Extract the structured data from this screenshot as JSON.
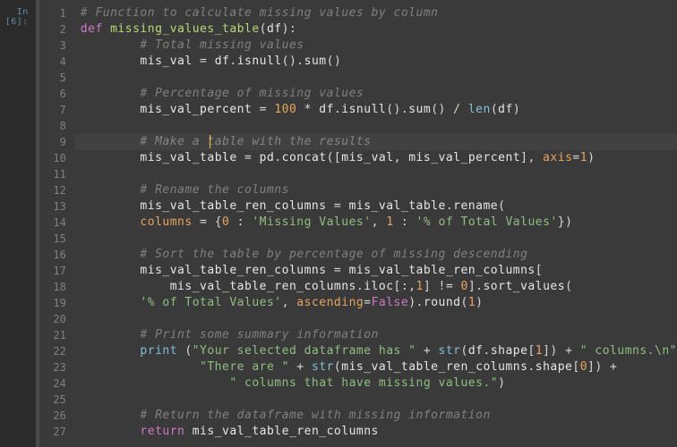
{
  "prompt": "In [6]:",
  "cursor_line": 9,
  "caret_col_ch": 18,
  "lines": [
    {
      "n": 1,
      "t": [
        [
          "c",
          "# Function to calculate missing values by column"
        ]
      ],
      "indent": 0
    },
    {
      "n": 2,
      "t": [
        [
          "kw",
          "def "
        ],
        [
          "fn",
          "missing_values_table"
        ],
        [
          "op",
          "("
        ],
        [
          "id",
          "df"
        ],
        [
          "op",
          "):"
        ]
      ],
      "indent": 0
    },
    {
      "n": 3,
      "t": [
        [
          "c",
          "# Total missing values"
        ]
      ],
      "indent": 2
    },
    {
      "n": 4,
      "t": [
        [
          "id",
          "mis_val "
        ],
        [
          "op",
          "= "
        ],
        [
          "id",
          "df"
        ],
        [
          "op",
          "."
        ],
        [
          "id",
          "isnull"
        ],
        [
          "op",
          "()."
        ],
        [
          "id",
          "sum"
        ],
        [
          "op",
          "()"
        ]
      ],
      "indent": 2
    },
    {
      "n": 5,
      "t": [],
      "indent": 0
    },
    {
      "n": 6,
      "t": [
        [
          "c",
          "# Percentage of missing values"
        ]
      ],
      "indent": 2
    },
    {
      "n": 7,
      "t": [
        [
          "id",
          "mis_val_percent "
        ],
        [
          "op",
          "= "
        ],
        [
          "nm",
          "100"
        ],
        [
          "op",
          " * "
        ],
        [
          "id",
          "df"
        ],
        [
          "op",
          "."
        ],
        [
          "id",
          "isnull"
        ],
        [
          "op",
          "()."
        ],
        [
          "id",
          "sum"
        ],
        [
          "op",
          "() / "
        ],
        [
          "bf",
          "len"
        ],
        [
          "op",
          "("
        ],
        [
          "id",
          "df"
        ],
        [
          "op",
          ")"
        ]
      ],
      "indent": 2
    },
    {
      "n": 8,
      "t": [],
      "indent": 0
    },
    {
      "n": 9,
      "t": [
        [
          "c",
          "# Make a table with the results"
        ]
      ],
      "indent": 2
    },
    {
      "n": 10,
      "t": [
        [
          "id",
          "mis_val_table "
        ],
        [
          "op",
          "= "
        ],
        [
          "id",
          "pd"
        ],
        [
          "op",
          "."
        ],
        [
          "id",
          "concat"
        ],
        [
          "op",
          "(["
        ],
        [
          "id",
          "mis_val"
        ],
        [
          "op",
          ", "
        ],
        [
          "id",
          "mis_val_percent"
        ],
        [
          "op",
          "], "
        ],
        [
          "kv",
          "axis"
        ],
        [
          "op",
          "="
        ],
        [
          "nm",
          "1"
        ],
        [
          "op",
          ")"
        ]
      ],
      "indent": 2
    },
    {
      "n": 11,
      "t": [],
      "indent": 0
    },
    {
      "n": 12,
      "t": [
        [
          "c",
          "# Rename the columns"
        ]
      ],
      "indent": 2
    },
    {
      "n": 13,
      "t": [
        [
          "id",
          "mis_val_table_ren_columns "
        ],
        [
          "op",
          "= "
        ],
        [
          "id",
          "mis_val_table"
        ],
        [
          "op",
          "."
        ],
        [
          "id",
          "rename"
        ],
        [
          "op",
          "("
        ]
      ],
      "indent": 2
    },
    {
      "n": 14,
      "t": [
        [
          "kv",
          "columns"
        ],
        [
          "op",
          " = {"
        ],
        [
          "nm",
          "0"
        ],
        [
          "op",
          " : "
        ],
        [
          "st",
          "'Missing Values'"
        ],
        [
          "op",
          ", "
        ],
        [
          "nm",
          "1"
        ],
        [
          "op",
          " : "
        ],
        [
          "st",
          "'% of Total Values'"
        ],
        [
          "op",
          "})"
        ]
      ],
      "indent": 2
    },
    {
      "n": 15,
      "t": [],
      "indent": 0
    },
    {
      "n": 16,
      "t": [
        [
          "c",
          "# Sort the table by percentage of missing descending"
        ]
      ],
      "indent": 2
    },
    {
      "n": 17,
      "t": [
        [
          "id",
          "mis_val_table_ren_columns "
        ],
        [
          "op",
          "= "
        ],
        [
          "id",
          "mis_val_table_ren_columns"
        ],
        [
          "op",
          "["
        ]
      ],
      "indent": 2
    },
    {
      "n": 18,
      "t": [
        [
          "id",
          "mis_val_table_ren_columns"
        ],
        [
          "op",
          "."
        ],
        [
          "id",
          "iloc"
        ],
        [
          "op",
          "[:,"
        ],
        [
          "nm",
          "1"
        ],
        [
          "op",
          "] != "
        ],
        [
          "nm",
          "0"
        ],
        [
          "op",
          "]."
        ],
        [
          "id",
          "sort_values"
        ],
        [
          "op",
          "("
        ]
      ],
      "indent": 3
    },
    {
      "n": 19,
      "t": [
        [
          "st",
          "'% of Total Values'"
        ],
        [
          "op",
          ", "
        ],
        [
          "kv",
          "ascending"
        ],
        [
          "op",
          "="
        ],
        [
          "bl",
          "False"
        ],
        [
          "op",
          ")."
        ],
        [
          "id",
          "round"
        ],
        [
          "op",
          "("
        ],
        [
          "nm",
          "1"
        ],
        [
          "op",
          ")"
        ]
      ],
      "indent": 2
    },
    {
      "n": 20,
      "t": [],
      "indent": 0
    },
    {
      "n": 21,
      "t": [
        [
          "c",
          "# Print some summary information"
        ]
      ],
      "indent": 2
    },
    {
      "n": 22,
      "t": [
        [
          "bf",
          "print"
        ],
        [
          "op",
          " ("
        ],
        [
          "st",
          "\"Your selected dataframe has \""
        ],
        [
          "op",
          " + "
        ],
        [
          "bf",
          "str"
        ],
        [
          "op",
          "("
        ],
        [
          "id",
          "df"
        ],
        [
          "op",
          "."
        ],
        [
          "id",
          "shape"
        ],
        [
          "op",
          "["
        ],
        [
          "nm",
          "1"
        ],
        [
          "op",
          "]) + "
        ],
        [
          "st",
          "\" columns.\\n\""
        ]
      ],
      "indent": 2
    },
    {
      "n": 23,
      "t": [
        [
          "st",
          "\"There are \""
        ],
        [
          "op",
          " + "
        ],
        [
          "bf",
          "str"
        ],
        [
          "op",
          "("
        ],
        [
          "id",
          "mis_val_table_ren_columns"
        ],
        [
          "op",
          "."
        ],
        [
          "id",
          "shape"
        ],
        [
          "op",
          "["
        ],
        [
          "nm",
          "0"
        ],
        [
          "op",
          "]) +"
        ]
      ],
      "indent": 4
    },
    {
      "n": 24,
      "t": [
        [
          "st",
          "\" columns that have missing values.\""
        ],
        [
          "op",
          ")"
        ]
      ],
      "indent": 5
    },
    {
      "n": 25,
      "t": [],
      "indent": 0
    },
    {
      "n": 26,
      "t": [
        [
          "c",
          "# Return the dataframe with missing information"
        ]
      ],
      "indent": 2
    },
    {
      "n": 27,
      "t": [
        [
          "kw",
          "return "
        ],
        [
          "id",
          "mis_val_table_ren_columns"
        ]
      ],
      "indent": 2
    }
  ]
}
